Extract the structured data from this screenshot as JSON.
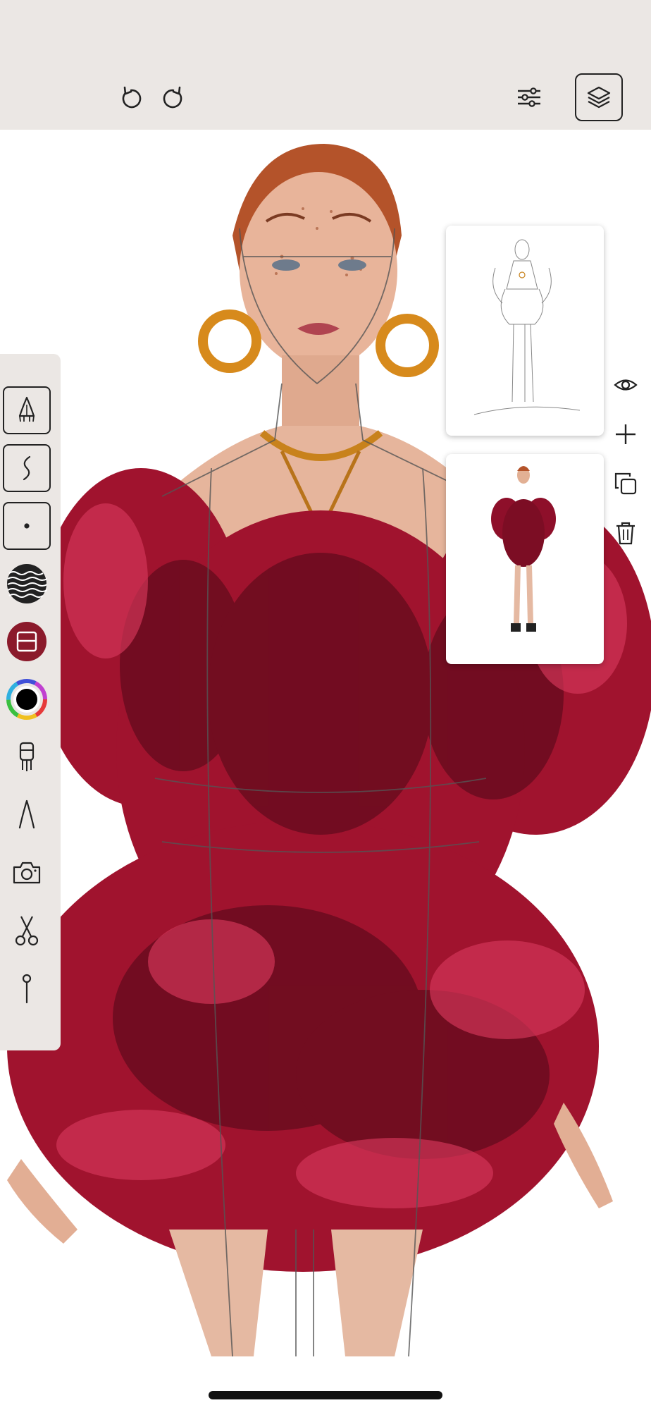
{
  "app": {
    "accent": "#8b1a2b",
    "toolbar_bg": "#ebe7e4"
  },
  "header": {
    "undo_icon": "undo-icon",
    "redo_icon": "redo-icon",
    "adjust_icon": "sliders-icon",
    "layers_icon": "layers-icon"
  },
  "tools": [
    {
      "name": "pen-tool",
      "icon": "pen-nib-icon",
      "boxed": true
    },
    {
      "name": "curve-tool",
      "icon": "s-curve-icon",
      "boxed": true
    },
    {
      "name": "dot-tool",
      "icon": "dot-icon",
      "boxed": true
    },
    {
      "name": "pattern-tool",
      "icon": "wave-pattern-icon"
    },
    {
      "name": "fill-tool",
      "icon": "fill-swatch-icon"
    },
    {
      "name": "color-picker",
      "icon": "color-wheel-icon"
    },
    {
      "name": "brush-tool",
      "icon": "brush-icon"
    },
    {
      "name": "pencil-tool",
      "icon": "compass-pen-icon"
    },
    {
      "name": "camera-tool",
      "icon": "camera-icon"
    },
    {
      "name": "scissors-tool",
      "icon": "scissors-icon"
    },
    {
      "name": "pin-tool",
      "icon": "pin-icon"
    }
  ],
  "layers": [
    {
      "name": "sketch-layer"
    },
    {
      "name": "color-layer"
    }
  ],
  "layer_actions": [
    {
      "name": "visibility",
      "icon": "eye-icon"
    },
    {
      "name": "add-layer",
      "icon": "plus-icon"
    },
    {
      "name": "duplicate-layer",
      "icon": "duplicate-icon"
    },
    {
      "name": "delete-layer",
      "icon": "trash-icon"
    }
  ]
}
